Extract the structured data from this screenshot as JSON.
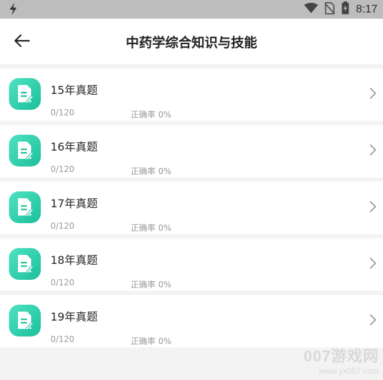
{
  "status_bar": {
    "app_icon": "notification-logo-icon",
    "icons": [
      "wifi-icon",
      "no-sim-icon",
      "battery-charging-icon"
    ],
    "time": "8:17"
  },
  "header": {
    "back_icon": "arrow-left-icon",
    "title": "中药学综合知识与技能"
  },
  "exams": [
    {
      "title": "15年真题",
      "count": "0/120",
      "rate": "正确率 0%"
    },
    {
      "title": "16年真题",
      "count": "0/120",
      "rate": "正确率 0%"
    },
    {
      "title": "17年真题",
      "count": "0/120",
      "rate": "正确率 0%"
    },
    {
      "title": "18年真题",
      "count": "0/120",
      "rate": "正确率 0%"
    },
    {
      "title": "19年真题",
      "count": "0/120",
      "rate": "正确率 0%"
    }
  ],
  "watermark": {
    "main": "007游戏网",
    "sub": "www.yx007.com"
  },
  "colors": {
    "accent_start": "#4fe3c2",
    "accent_end": "#1cbf9b",
    "background": "#f3f3f3"
  }
}
